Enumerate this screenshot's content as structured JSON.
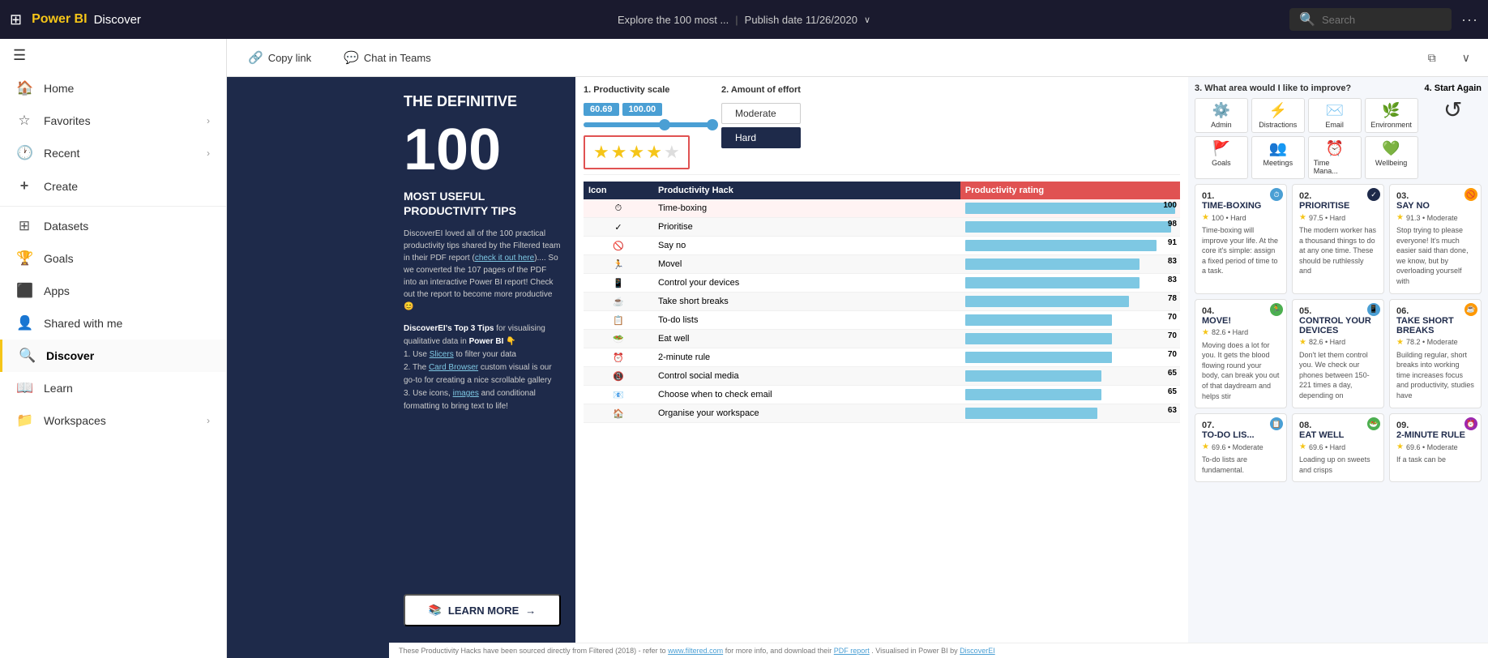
{
  "topbar": {
    "grid_icon": "⊞",
    "logo": "Power BI",
    "app_name": "Discover",
    "title": "Explore the 100 most ...",
    "pipe": "|",
    "publish": "Publish date 11/26/2020",
    "chevron": "∨",
    "search_placeholder": "Search",
    "more": "···"
  },
  "sidebar": {
    "hamburger": "☰",
    "items": [
      {
        "id": "home",
        "icon": "🏠",
        "label": "Home",
        "has_arrow": false
      },
      {
        "id": "favorites",
        "icon": "☆",
        "label": "Favorites",
        "has_arrow": true
      },
      {
        "id": "recent",
        "icon": "🕐",
        "label": "Recent",
        "has_arrow": true
      },
      {
        "id": "create",
        "icon": "+",
        "label": "Create",
        "has_arrow": false
      },
      {
        "id": "datasets",
        "icon": "⊞",
        "label": "Datasets",
        "has_arrow": false
      },
      {
        "id": "goals",
        "icon": "🏆",
        "label": "Goals",
        "has_arrow": false
      },
      {
        "id": "apps",
        "icon": "📦",
        "label": "Apps",
        "has_arrow": false
      },
      {
        "id": "shared",
        "icon": "👤",
        "label": "Shared with me",
        "has_arrow": false
      },
      {
        "id": "discover",
        "icon": "🔍",
        "label": "Discover",
        "has_arrow": false,
        "active": true
      },
      {
        "id": "learn",
        "icon": "📖",
        "label": "Learn",
        "has_arrow": false
      },
      {
        "id": "workspaces",
        "icon": "📁",
        "label": "Workspaces",
        "has_arrow": true
      }
    ]
  },
  "toolbar": {
    "copy_link_label": "Copy link",
    "chat_teams_label": "Chat in Teams",
    "window_icon": "⧉",
    "chevron_icon": "∨"
  },
  "intro": {
    "title": "THE DEFINITIVE",
    "number": "100",
    "subtitle": "MOST USEFUL\nPRODUCTIVITY TIPS",
    "description": "DiscoverEI loved all of the 100 practical productivity tips shared by the Filtered team in their PDF report (check it out here).... So we converted the 107 pages of the PDF into an interactive Power BI report! Check out the report to become more productive 😊",
    "tips_title": "DiscoverEI's Top 3 Tips for visualising qualitative data in Power BI 👇",
    "tip1": "1. Use Slicers to filter your data",
    "tip2": "2. The Card Browser custom visual is our go-to for creating a nice scrollable gallery",
    "tip3": "3. Use icons, images and conditional formatting to bring text to life!",
    "learn_more": "LEARN MORE",
    "learn_more_arrow": "→"
  },
  "sliders": {
    "productivity_label": "1. Productivity scale",
    "value1": "60.69",
    "value2": "100.00",
    "effort_label": "2. Amount of effort",
    "effort_options": [
      "Moderate",
      "Hard"
    ],
    "effort_selected": "Hard"
  },
  "stars": {
    "filled": 4,
    "empty": 1
  },
  "table": {
    "col_icon": "Icon",
    "col_hack": "Productivity Hack",
    "col_rating": "Productivity rating",
    "rows": [
      {
        "icon": "⏱",
        "hack": "Time-boxing",
        "rating": 100,
        "bar_pct": 100
      },
      {
        "icon": "✓",
        "hack": "Prioritise",
        "rating": 98,
        "bar_pct": 98
      },
      {
        "icon": "🚫",
        "hack": "Say no",
        "rating": 91,
        "bar_pct": 91
      },
      {
        "icon": "🏃",
        "hack": "Movel",
        "rating": 83,
        "bar_pct": 83
      },
      {
        "icon": "📱",
        "hack": "Control your devices",
        "rating": 83,
        "bar_pct": 83
      },
      {
        "icon": "☕",
        "hack": "Take short breaks",
        "rating": 78,
        "bar_pct": 78
      },
      {
        "icon": "📋",
        "hack": "To-do lists",
        "rating": 70,
        "bar_pct": 70
      },
      {
        "icon": "🥗",
        "hack": "Eat well",
        "rating": 70,
        "bar_pct": 70
      },
      {
        "icon": "⏰",
        "hack": "2-minute rule",
        "rating": 70,
        "bar_pct": 70
      },
      {
        "icon": "📵",
        "hack": "Control social media",
        "rating": 65,
        "bar_pct": 65
      },
      {
        "icon": "📧",
        "hack": "Choose when to check email",
        "rating": 65,
        "bar_pct": 65
      },
      {
        "icon": "🏠",
        "hack": "Organise your workspace",
        "rating": 63,
        "bar_pct": 63
      }
    ]
  },
  "filter": {
    "area_label": "3. What area would I like to improve?",
    "icons": [
      {
        "icon": "⚙️",
        "label": "Admin",
        "color": "blue"
      },
      {
        "icon": "⚡",
        "label": "Distractions",
        "color": "blue"
      },
      {
        "icon": "✉️",
        "label": "Email",
        "color": "blue"
      },
      {
        "icon": "🌿",
        "label": "Environment",
        "color": "green"
      },
      {
        "icon": "🚩",
        "label": "Goals",
        "color": "blue"
      },
      {
        "icon": "👥",
        "label": "Meetings",
        "color": "blue"
      },
      {
        "icon": "⏰",
        "label": "Time Mana...",
        "color": "blue"
      },
      {
        "icon": "💚",
        "label": "Wellbeing",
        "color": "green"
      }
    ],
    "start_again_label": "4. Start Again"
  },
  "cards": [
    {
      "number": "01.",
      "title": "TIME-BOXING",
      "rating": "100 • Hard",
      "stars": "★",
      "description": "Time-boxing will improve your life. At the core it's simple: assign a fixed period of time to a task.",
      "badge": "⏱",
      "badge_color": "blue"
    },
    {
      "number": "02.",
      "title": "PRIORITISE",
      "rating": "97.5 • Hard",
      "stars": "★",
      "description": "The modern worker has a thousand things to do at any one time. These should be ruthlessly and",
      "badge": "✓",
      "badge_color": "dark"
    },
    {
      "number": "03.",
      "title": "SAY NO",
      "rating": "91.3 • Moderate",
      "stars": "★",
      "description": "Stop trying to please everyone! It's much easier said than done, we know, but by overloading yourself with",
      "badge": "🚫",
      "badge_color": "orange"
    },
    {
      "number": "04.",
      "title": "MOVE!",
      "rating": "82.6 • Hard",
      "stars": "★",
      "description": "Moving does a lot for you. It gets the blood flowing round your body, can break you out of that daydream and helps stir",
      "badge": "🏃",
      "badge_color": "green"
    },
    {
      "number": "05.",
      "title": "CONTROL YOUR DEVICES",
      "rating": "82.6 • Hard",
      "stars": "★",
      "description": "Don't let them control you. We check our phones between 150-221 times a day, depending on",
      "badge": "📱",
      "badge_color": "blue"
    },
    {
      "number": "06.",
      "title": "TAKE SHORT BREAKS",
      "rating": "78.2 • Moderate",
      "stars": "★",
      "description": "Building regular, short breaks into working time increases focus and productivity, studies have",
      "badge": "☕",
      "badge_color": "orange"
    },
    {
      "number": "07.",
      "title": "TO-DO LIS...",
      "rating": "69.6 • Moderate",
      "stars": "★",
      "description": "To-do lists are fundamental.",
      "badge": "📋",
      "badge_color": "blue"
    },
    {
      "number": "08.",
      "title": "EAT WELL",
      "rating": "69.6 • Hard",
      "stars": "★",
      "description": "Loading up on sweets and crisps",
      "badge": "🥗",
      "badge_color": "green"
    },
    {
      "number": "09.",
      "title": "2-MINUTE RULE",
      "rating": "69.6 • Moderate",
      "stars": "★",
      "description": "If a task can be",
      "badge": "⏰",
      "badge_color": "purple"
    }
  ],
  "footer": {
    "text": "These Productivity Hacks have been sourced directly from Filtered (2018) - refer to ",
    "link1_text": "www.filtered.com",
    "link1_url": "#",
    "middle": " for more info, and download their ",
    "link2_text": "PDF report",
    "link2_url": "#",
    "end": ". Visualised in Power BI by ",
    "link3_text": "DiscoverEI",
    "link3_url": "#"
  }
}
